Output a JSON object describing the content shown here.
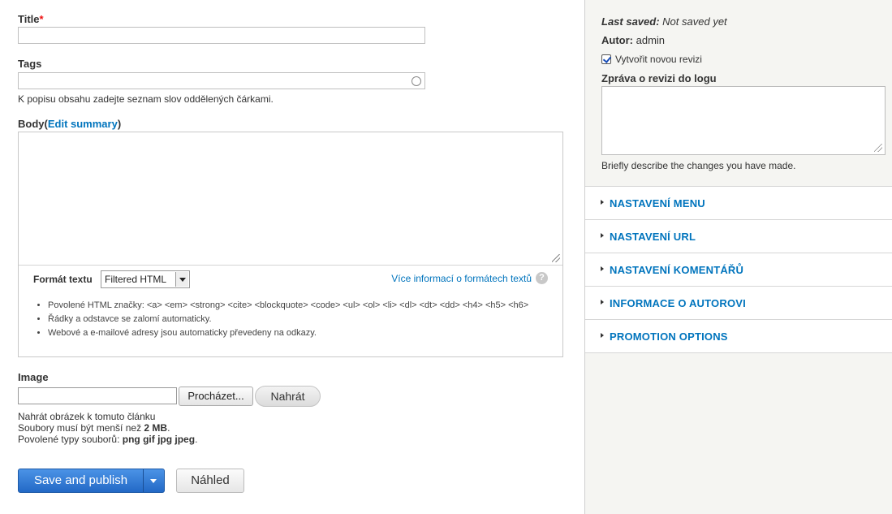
{
  "form": {
    "title": {
      "label": "Title",
      "required_mark": "*",
      "value": ""
    },
    "tags": {
      "label": "Tags",
      "value": "",
      "description": "K popisu obsahu zadejte seznam slov oddělených čárkami."
    },
    "body": {
      "label": "Body",
      "paren_open": "(",
      "edit_summary_link": "Edit summary",
      "paren_close": ")",
      "value": "",
      "format_label": "Formát textu",
      "format_selected": "Filtered HTML",
      "format_more_link": "Více informací o formátech textů",
      "help_icon": "?",
      "tips": [
        "Povolené HTML značky: <a> <em> <strong> <cite> <blockquote> <code> <ul> <ol> <li> <dl> <dt> <dd> <h4> <h5> <h6>",
        "Řádky a odstavce se zalomí automaticky.",
        "Webové a e-mailové adresy jsou automaticky převedeny na odkazy."
      ]
    },
    "image": {
      "label": "Image",
      "browse_label": "Procházet...",
      "upload_label": "Nahrát",
      "desc_line1": "Nahrát obrázek k tomuto článku",
      "desc_line2_prefix": "Soubory musí být menší než ",
      "desc_line2_size": "2 MB",
      "desc_line2_suffix": ".",
      "desc_line3_prefix": "Povolené typy souborů: ",
      "desc_line3_types": "png gif jpg jpeg",
      "desc_line3_suffix": "."
    },
    "actions": {
      "save_label": "Save and publish",
      "preview_label": "Náhled"
    }
  },
  "sidebar": {
    "last_saved_label": "Last saved:",
    "last_saved_value": "Not saved yet",
    "author_label": "Autor:",
    "author_value": "admin",
    "new_revision_label": "Vytvořit novou revizi",
    "new_revision_checked": true,
    "revision_log_label": "Zpráva o revizi do logu",
    "revision_log_value": "",
    "revision_log_description": "Briefly describe the changes you have made.",
    "sections": [
      {
        "title": "NASTAVENÍ MENU"
      },
      {
        "title": "NASTAVENÍ URL"
      },
      {
        "title": "NASTAVENÍ KOMENTÁŘŮ"
      },
      {
        "title": "INFORMACE O AUTOROVI"
      },
      {
        "title": "PROMOTION OPTIONS"
      }
    ]
  },
  "colors": {
    "link": "#0074bd",
    "primary_button": "#2f78d5",
    "required": "#ee1111"
  }
}
